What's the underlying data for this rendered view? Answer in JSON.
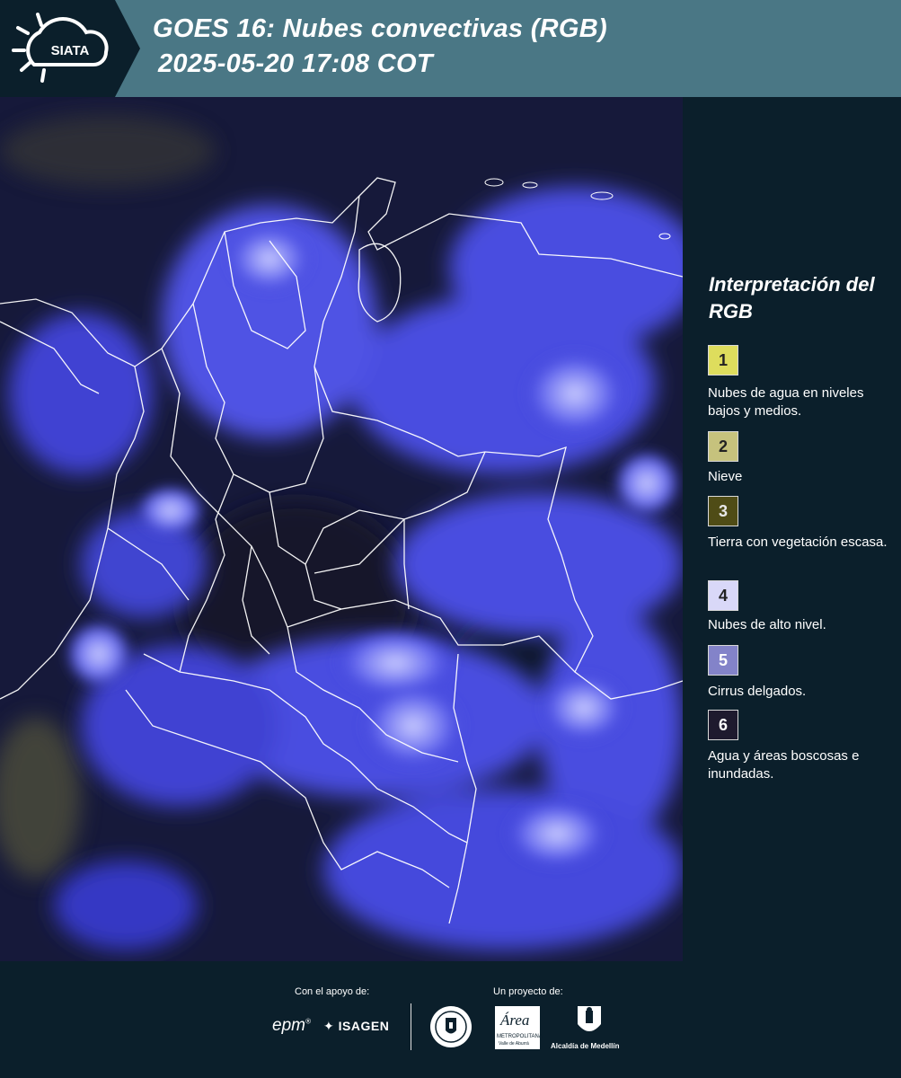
{
  "header": {
    "logo_text": "SIATA",
    "title_line1": "GOES 16: Nubes convectivas (RGB)",
    "title_line2": "2025-05-20 17:08 COT"
  },
  "legend": {
    "title": "Interpretación del RGB",
    "items": [
      {
        "number": "1",
        "label": "Nubes de agua en niveles bajos y medios.",
        "color": "#dedd5d"
      },
      {
        "number": "2",
        "label": "Nieve",
        "color": "#c6c27d"
      },
      {
        "number": "3",
        "label": "Tierra con vegetación escasa.",
        "color": "#4f4c16"
      },
      {
        "number": "4",
        "label": "Nubes de alto nivel.",
        "color": "#d9d8f8"
      },
      {
        "number": "5",
        "label": "Cirrus delgados.",
        "color": "#8383c9"
      },
      {
        "number": "6",
        "label": "Agua y áreas boscosas e inundadas.",
        "color": "#1e1a2e"
      }
    ]
  },
  "footer": {
    "support_label": "Con el apoyo de:",
    "project_label": "Un proyecto de:",
    "sponsor_epm": "epm",
    "sponsor_isagen": "ISAGEN",
    "area_caption": "METROPOLITANA",
    "area_sub": "Valle de Aburrá",
    "area_script": "Área",
    "alcaldia_caption": "Alcaldía de Medellín"
  },
  "icons": {
    "logo": "sun-cloud-icon",
    "seal": "medellin-seal-icon",
    "area_logo": "area-metropolitana-logo",
    "alcaldia_logo": "alcaldia-shield-logo",
    "isagen_mark": "isagen-star-icon"
  },
  "colors": {
    "header_bg": "#4a7785",
    "logo_bg": "#0b1f2b",
    "page_bg": "#0b1f2b",
    "cloud_blue": "#4a4ee0",
    "border_white": "#ffffff"
  }
}
